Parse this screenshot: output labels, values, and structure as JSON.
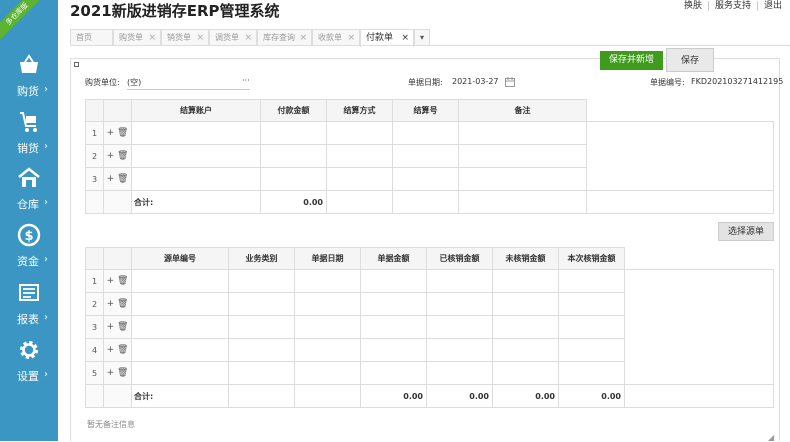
{
  "corner_badge": "多仓库版",
  "app_title": "2021新版进销存ERP管理系统",
  "top_links": [
    "换肤",
    "服务支持",
    "退出"
  ],
  "nav": [
    {
      "label": "购货",
      "arrow": "›",
      "icon": "basket-icon"
    },
    {
      "label": "销货",
      "arrow": "›",
      "icon": "cart-icon"
    },
    {
      "label": "仓库",
      "arrow": "›",
      "icon": "warehouse-icon"
    },
    {
      "label": "资金",
      "arrow": "›",
      "icon": "money-icon"
    },
    {
      "label": "报表",
      "arrow": "›",
      "icon": "report-icon"
    },
    {
      "label": "设置",
      "arrow": "›",
      "icon": "gear-icon"
    }
  ],
  "tabs": [
    {
      "label": "首页",
      "close": ""
    },
    {
      "label": "购货单",
      "close": "×"
    },
    {
      "label": "销货单",
      "close": "×"
    },
    {
      "label": "调货单",
      "close": "×"
    },
    {
      "label": "库存查询",
      "close": "×"
    },
    {
      "label": "收款单",
      "close": "×"
    },
    {
      "label": "付款单",
      "close": "×"
    }
  ],
  "tab_more": "▾",
  "buttons": {
    "save_new": "保存并新增",
    "save": "保存",
    "select_source": "选择源单"
  },
  "form": {
    "supplier_label": "购货单位:",
    "supplier_value": "(空)",
    "supplier_more": "···",
    "date_label": "单据日期:",
    "date_value": "2021-03-27",
    "docno_label": "单据编号:",
    "docno_value": "FKD202103271412195"
  },
  "settle_table": {
    "headers": [
      "结算账户",
      "付款金额",
      "结算方式",
      "结算号",
      "备注"
    ],
    "rows": [
      "1",
      "2",
      "3"
    ],
    "actions": "+ 🗑",
    "total_label": "合计:",
    "total_amount": "0.00"
  },
  "source_table": {
    "headers": [
      "源单编号",
      "业务类别",
      "单据日期",
      "单据金额",
      "已核销金额",
      "未核销金额",
      "本次核销金额"
    ],
    "rows": [
      "1",
      "2",
      "3",
      "4",
      "5"
    ],
    "actions": "+ 🗑",
    "total_label": "合计:",
    "totals": [
      "0.00",
      "0.00",
      "0.00",
      "0.00"
    ]
  },
  "note_placeholder": "暂无备注信息",
  "colors": {
    "sidebar": "#3b96c3",
    "accent_green": "#3f9b1c",
    "badge": "#5db42e"
  }
}
